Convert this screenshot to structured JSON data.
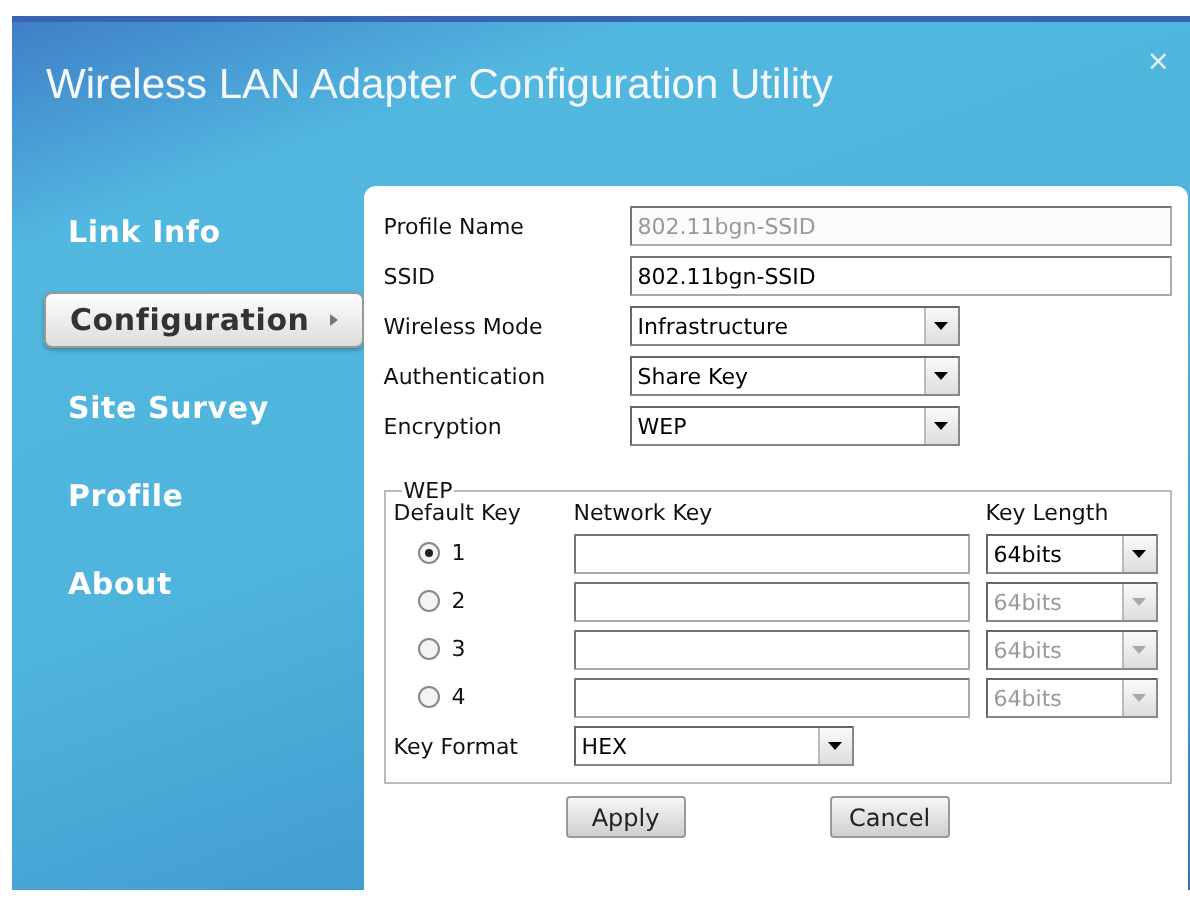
{
  "window": {
    "title": "Wireless LAN Adapter Configuration Utility",
    "close": "×"
  },
  "sidebar": {
    "items": [
      {
        "label": "Link Info",
        "selected": false
      },
      {
        "label": "Configuration",
        "selected": true
      },
      {
        "label": "Site Survey",
        "selected": false
      },
      {
        "label": "Profile",
        "selected": false
      },
      {
        "label": "About",
        "selected": false
      }
    ]
  },
  "form": {
    "fields": [
      {
        "kind": "text",
        "label": "Profile Name",
        "value": "802.11bgn-SSID",
        "disabled": true
      },
      {
        "kind": "text",
        "label": "SSID",
        "value": "802.11bgn-SSID",
        "disabled": false
      },
      {
        "kind": "select",
        "label": "Wireless Mode",
        "value": "Infrastructure",
        "disabled": false
      },
      {
        "kind": "select",
        "label": "Authentication",
        "value": "Share Key",
        "disabled": false
      },
      {
        "kind": "select",
        "label": "Encryption",
        "value": "WEP",
        "disabled": false
      }
    ]
  },
  "wep": {
    "title": "WEP",
    "columns": [
      "Default Key",
      "Network Key",
      "Key Length"
    ],
    "keys": [
      {
        "number": "1",
        "selected": true,
        "key_length": "64bits",
        "disabled": false
      },
      {
        "number": "2",
        "selected": false,
        "key_length": "64bits",
        "disabled": true
      },
      {
        "number": "3",
        "selected": false,
        "key_length": "64bits",
        "disabled": true
      },
      {
        "number": "4",
        "selected": false,
        "key_length": "64bits",
        "disabled": true
      }
    ],
    "key_format": {
      "label": "Key Format",
      "value": "HEX"
    }
  },
  "buttons": [
    "Apply",
    "Cancel"
  ]
}
